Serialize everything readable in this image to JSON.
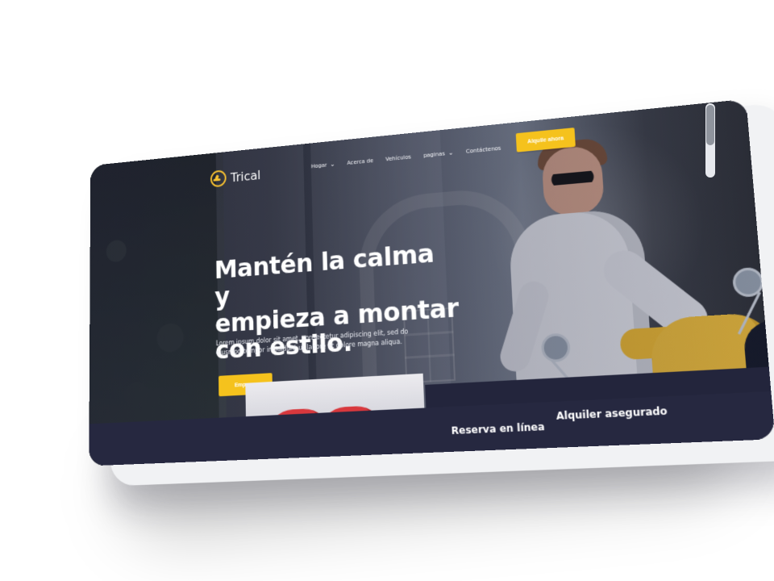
{
  "header": {
    "logo_text": "Trical",
    "nav": [
      {
        "label": "Hogar",
        "has_dropdown": true
      },
      {
        "label": "Acerca de",
        "has_dropdown": false
      },
      {
        "label": "Vehículos",
        "has_dropdown": false
      },
      {
        "label": "paginas",
        "has_dropdown": true
      },
      {
        "label": "Contáctenos",
        "has_dropdown": false
      }
    ],
    "cta_label": "Alquile ahora"
  },
  "hero": {
    "title": "Mantén la calma y\nempieza a montar\ncon estilo.",
    "description": "Lorem ipsum dolor sit amet, consectetur adipiscing elit, sed do eiusmod tempor incididunt ut labore et dolore magna aliqua.",
    "button_label": "Empezar"
  },
  "features": [
    {
      "label": "Reserva en línea"
    },
    {
      "label": "Alquiler asegurado"
    }
  ],
  "colors": {
    "accent": "#f5c21d",
    "navy": "#262840",
    "text_light": "#ffffff"
  },
  "icons": {
    "logo": "scooter-icon",
    "dropdown": "chevron-down-icon"
  }
}
